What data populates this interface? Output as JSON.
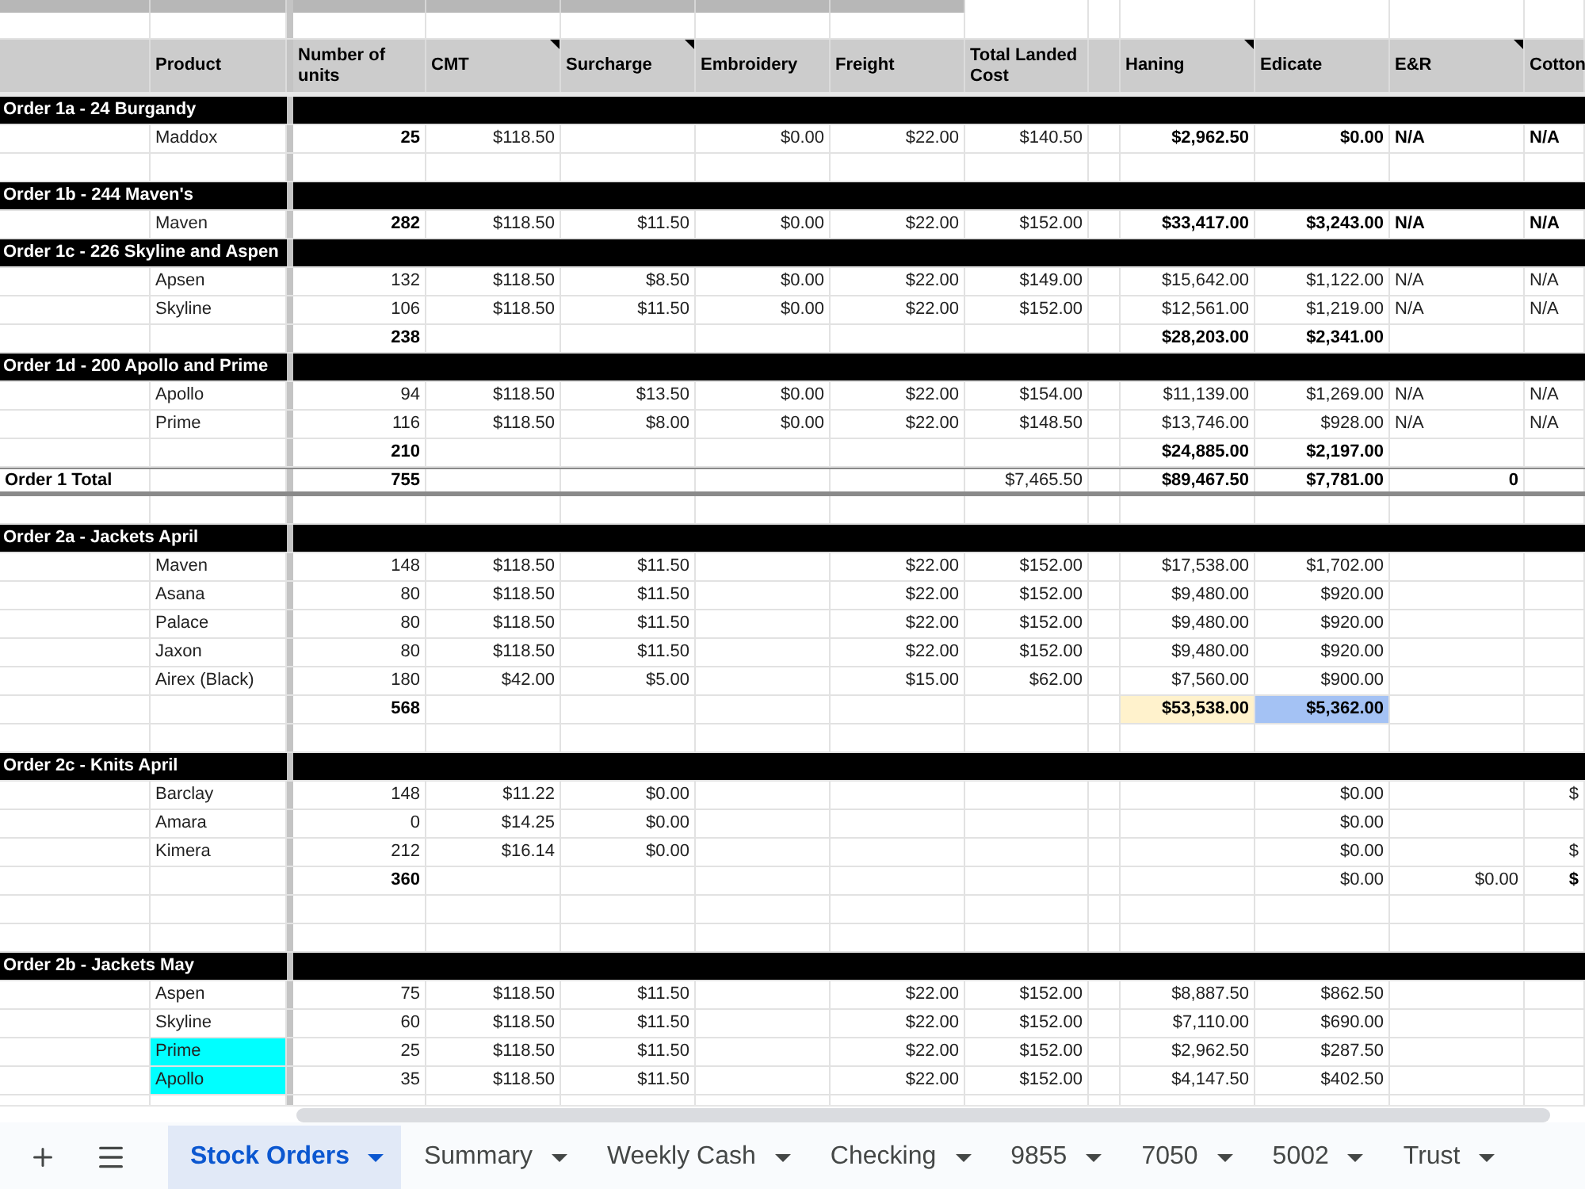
{
  "columns": [
    {
      "note": false
    },
    {
      "label": "Product",
      "note": false
    },
    {
      "label": "Number of units",
      "note": false
    },
    {
      "label": "CMT",
      "note": true
    },
    {
      "label": "Surcharge",
      "note": true
    },
    {
      "label": "Embroidery",
      "note": false
    },
    {
      "label": "Freight",
      "note": false
    },
    {
      "label": "Total Landed Cost",
      "note": false
    },
    {
      "note": false
    },
    {
      "label": "Haning",
      "note": true
    },
    {
      "label": "Edicate",
      "note": false
    },
    {
      "label": "E&R",
      "note": true
    },
    {
      "label": "Cotton",
      "note": false
    }
  ],
  "rows": [
    {
      "kind": "group",
      "label": "Order 1a - 24 Burgandy"
    },
    {
      "kind": "data",
      "cells": {
        "product": {
          "text": "Maddox",
          "bold": false
        },
        "number_of_units": {
          "text": "25",
          "bold": true
        },
        "cmt": {
          "text": "$118.50",
          "bold": false
        },
        "embroidery": {
          "text": "$0.00",
          "bold": false
        },
        "freight": {
          "text": "$22.00",
          "bold": false
        },
        "total_landed_cost": {
          "text": "$140.50",
          "bold": false
        },
        "haning": {
          "text": "$2,962.50",
          "bold": true
        },
        "edicate": {
          "text": "$0.00",
          "bold": true
        },
        "e_r": {
          "text": "N/A",
          "bold": true
        },
        "cotton": {
          "text": "N/A",
          "bold": true
        }
      }
    },
    {
      "kind": "blank"
    },
    {
      "kind": "group",
      "label": "Order 1b - 244 Maven's"
    },
    {
      "kind": "data",
      "cells": {
        "product": {
          "text": "Maven",
          "bold": false
        },
        "number_of_units": {
          "text": "282",
          "bold": true
        },
        "cmt": {
          "text": "$118.50",
          "bold": false
        },
        "surcharge": {
          "text": "$11.50",
          "bold": false
        },
        "embroidery": {
          "text": "$0.00",
          "bold": false
        },
        "freight": {
          "text": "$22.00",
          "bold": false
        },
        "total_landed_cost": {
          "text": "$152.00",
          "bold": false
        },
        "haning": {
          "text": "$33,417.00",
          "bold": true
        },
        "edicate": {
          "text": "$3,243.00",
          "bold": true
        },
        "e_r": {
          "text": "N/A",
          "bold": true
        },
        "cotton": {
          "text": "N/A",
          "bold": true
        }
      }
    },
    {
      "kind": "group",
      "label": "Order 1c - 226 Skyline and Aspen"
    },
    {
      "kind": "data",
      "cells": {
        "product": {
          "text": "Apsen",
          "bold": false
        },
        "number_of_units": {
          "text": "132",
          "bold": false
        },
        "cmt": {
          "text": "$118.50",
          "bold": false
        },
        "surcharge": {
          "text": "$8.50",
          "bold": false
        },
        "embroidery": {
          "text": "$0.00",
          "bold": false
        },
        "freight": {
          "text": "$22.00",
          "bold": false
        },
        "total_landed_cost": {
          "text": "$149.00",
          "bold": false
        },
        "haning": {
          "text": "$15,642.00",
          "bold": false
        },
        "edicate": {
          "text": "$1,122.00",
          "bold": false
        },
        "e_r": {
          "text": "N/A",
          "bold": false
        },
        "cotton": {
          "text": "N/A",
          "bold": false
        }
      }
    },
    {
      "kind": "data",
      "cells": {
        "product": {
          "text": "Skyline",
          "bold": false
        },
        "number_of_units": {
          "text": "106",
          "bold": false
        },
        "cmt": {
          "text": "$118.50",
          "bold": false
        },
        "surcharge": {
          "text": "$11.50",
          "bold": false
        },
        "embroidery": {
          "text": "$0.00",
          "bold": false
        },
        "freight": {
          "text": "$22.00",
          "bold": false
        },
        "total_landed_cost": {
          "text": "$152.00",
          "bold": false
        },
        "haning": {
          "text": "$12,561.00",
          "bold": false
        },
        "edicate": {
          "text": "$1,219.00",
          "bold": false
        },
        "e_r": {
          "text": "N/A",
          "bold": false
        },
        "cotton": {
          "text": "N/A",
          "bold": false
        }
      }
    },
    {
      "kind": "data",
      "cells": {
        "number_of_units": {
          "text": "238",
          "bold": true
        },
        "haning": {
          "text": "$28,203.00",
          "bold": true
        },
        "edicate": {
          "text": "$2,341.00",
          "bold": true
        }
      }
    },
    {
      "kind": "group",
      "label": "Order 1d - 200 Apollo and Prime"
    },
    {
      "kind": "data",
      "cells": {
        "product": {
          "text": "Apollo",
          "bold": false
        },
        "number_of_units": {
          "text": "94",
          "bold": false
        },
        "cmt": {
          "text": "$118.50",
          "bold": false
        },
        "surcharge": {
          "text": "$13.50",
          "bold": false
        },
        "embroidery": {
          "text": "$0.00",
          "bold": false
        },
        "freight": {
          "text": "$22.00",
          "bold": false
        },
        "total_landed_cost": {
          "text": "$154.00",
          "bold": false
        },
        "haning": {
          "text": "$11,139.00",
          "bold": false
        },
        "edicate": {
          "text": "$1,269.00",
          "bold": false
        },
        "e_r": {
          "text": "N/A",
          "bold": false
        },
        "cotton": {
          "text": "N/A",
          "bold": false
        }
      }
    },
    {
      "kind": "data",
      "cells": {
        "product": {
          "text": "Prime",
          "bold": false
        },
        "number_of_units": {
          "text": "116",
          "bold": false
        },
        "cmt": {
          "text": "$118.50",
          "bold": false
        },
        "surcharge": {
          "text": "$8.00",
          "bold": false
        },
        "embroidery": {
          "text": "$0.00",
          "bold": false
        },
        "freight": {
          "text": "$22.00",
          "bold": false
        },
        "total_landed_cost": {
          "text": "$148.50",
          "bold": false
        },
        "haning": {
          "text": "$13,746.00",
          "bold": false
        },
        "edicate": {
          "text": "$928.00",
          "bold": false
        },
        "e_r": {
          "text": "N/A",
          "bold": false
        },
        "cotton": {
          "text": "N/A",
          "bold": false
        }
      }
    },
    {
      "kind": "data",
      "cells": {
        "number_of_units": {
          "text": "210",
          "bold": true
        },
        "haning": {
          "text": "$24,885.00",
          "bold": true
        },
        "edicate": {
          "text": "$2,197.00",
          "bold": true
        }
      }
    },
    {
      "kind": "total",
      "cells": {
        "column_1": {
          "text": "Order 1 Total",
          "bold": true
        },
        "number_of_units": {
          "text": "755",
          "bold": true
        },
        "total_landed_cost": {
          "text": "$7,465.50",
          "bold": false
        },
        "haning": {
          "text": "$89,467.50",
          "bold": true
        },
        "edicate": {
          "text": "$7,781.00",
          "bold": true
        },
        "e_r": {
          "text": "0",
          "bold": true
        }
      }
    },
    {
      "kind": "blank"
    },
    {
      "kind": "group",
      "label": "Order 2a - Jackets April"
    },
    {
      "kind": "data",
      "cells": {
        "product": {
          "text": "Maven",
          "bold": false
        },
        "number_of_units": {
          "text": "148",
          "bold": false
        },
        "cmt": {
          "text": "$118.50",
          "bold": false
        },
        "surcharge": {
          "text": "$11.50",
          "bold": false
        },
        "freight": {
          "text": "$22.00",
          "bold": false
        },
        "total_landed_cost": {
          "text": "$152.00",
          "bold": false
        },
        "haning": {
          "text": "$17,538.00",
          "bold": false
        },
        "edicate": {
          "text": "$1,702.00",
          "bold": false
        }
      }
    },
    {
      "kind": "data",
      "cells": {
        "product": {
          "text": "Asana",
          "bold": false
        },
        "number_of_units": {
          "text": "80",
          "bold": false
        },
        "cmt": {
          "text": "$118.50",
          "bold": false
        },
        "surcharge": {
          "text": "$11.50",
          "bold": false
        },
        "freight": {
          "text": "$22.00",
          "bold": false
        },
        "total_landed_cost": {
          "text": "$152.00",
          "bold": false
        },
        "haning": {
          "text": "$9,480.00",
          "bold": false
        },
        "edicate": {
          "text": "$920.00",
          "bold": false
        }
      }
    },
    {
      "kind": "data",
      "cells": {
        "product": {
          "text": "Palace",
          "bold": false
        },
        "number_of_units": {
          "text": "80",
          "bold": false
        },
        "cmt": {
          "text": "$118.50",
          "bold": false
        },
        "surcharge": {
          "text": "$11.50",
          "bold": false
        },
        "freight": {
          "text": "$22.00",
          "bold": false
        },
        "total_landed_cost": {
          "text": "$152.00",
          "bold": false
        },
        "haning": {
          "text": "$9,480.00",
          "bold": false
        },
        "edicate": {
          "text": "$920.00",
          "bold": false
        }
      }
    },
    {
      "kind": "data",
      "cells": {
        "product": {
          "text": "Jaxon",
          "bold": false
        },
        "number_of_units": {
          "text": "80",
          "bold": false
        },
        "cmt": {
          "text": "$118.50",
          "bold": false
        },
        "surcharge": {
          "text": "$11.50",
          "bold": false
        },
        "freight": {
          "text": "$22.00",
          "bold": false
        },
        "total_landed_cost": {
          "text": "$152.00",
          "bold": false
        },
        "haning": {
          "text": "$9,480.00",
          "bold": false
        },
        "edicate": {
          "text": "$920.00",
          "bold": false
        }
      }
    },
    {
      "kind": "data",
      "cells": {
        "product": {
          "text": "Airex (Black)",
          "bold": false
        },
        "number_of_units": {
          "text": "180",
          "bold": false
        },
        "cmt": {
          "text": "$42.00",
          "bold": false
        },
        "surcharge": {
          "text": "$5.00",
          "bold": false
        },
        "freight": {
          "text": "$15.00",
          "bold": false
        },
        "total_landed_cost": {
          "text": "$62.00",
          "bold": false
        },
        "haning": {
          "text": "$7,560.00",
          "bold": false
        },
        "edicate": {
          "text": "$900.00",
          "bold": false
        }
      }
    },
    {
      "kind": "data",
      "cells": {
        "number_of_units": {
          "text": "568",
          "bold": true
        },
        "haning": {
          "text": "$53,538.00",
          "bold": true,
          "color": "#fff2cc"
        },
        "edicate": {
          "text": "$5,362.00",
          "bold": true,
          "color": "#a4c2f4"
        }
      }
    },
    {
      "kind": "blank"
    },
    {
      "kind": "group",
      "label": "Order 2c - Knits April"
    },
    {
      "kind": "data",
      "cells": {
        "product": {
          "text": "Barclay",
          "bold": false
        },
        "number_of_units": {
          "text": "148",
          "bold": false
        },
        "cmt": {
          "text": "$11.22",
          "bold": false
        },
        "surcharge": {
          "text": "$0.00",
          "bold": false
        },
        "edicate": {
          "text": "$0.00",
          "bold": false
        },
        "cotton": {
          "text": "$",
          "bold": false
        }
      }
    },
    {
      "kind": "data",
      "cells": {
        "product": {
          "text": "Amara",
          "bold": false
        },
        "number_of_units": {
          "text": "0",
          "bold": false
        },
        "cmt": {
          "text": "$14.25",
          "bold": false
        },
        "surcharge": {
          "text": "$0.00",
          "bold": false
        },
        "edicate": {
          "text": "$0.00",
          "bold": false
        }
      }
    },
    {
      "kind": "data",
      "cells": {
        "product": {
          "text": "Kimera",
          "bold": false
        },
        "number_of_units": {
          "text": "212",
          "bold": false
        },
        "cmt": {
          "text": "$16.14",
          "bold": false
        },
        "surcharge": {
          "text": "$0.00",
          "bold": false
        },
        "edicate": {
          "text": "$0.00",
          "bold": false
        },
        "cotton": {
          "text": "$",
          "bold": false
        }
      }
    },
    {
      "kind": "data",
      "cells": {
        "number_of_units": {
          "text": "360",
          "bold": true
        },
        "edicate": {
          "text": "$0.00",
          "bold": false
        },
        "e_r": {
          "text": "$0.00",
          "bold": false
        },
        "cotton": {
          "text": "$",
          "bold": true
        }
      }
    },
    {
      "kind": "blank"
    },
    {
      "kind": "blank"
    },
    {
      "kind": "group",
      "label": "Order 2b - Jackets May"
    },
    {
      "kind": "data",
      "cells": {
        "product": {
          "text": "Aspen",
          "bold": false
        },
        "number_of_units": {
          "text": "75",
          "bold": false
        },
        "cmt": {
          "text": "$118.50",
          "bold": false
        },
        "surcharge": {
          "text": "$11.50",
          "bold": false
        },
        "freight": {
          "text": "$22.00",
          "bold": false
        },
        "total_landed_cost": {
          "text": "$152.00",
          "bold": false
        },
        "haning": {
          "text": "$8,887.50",
          "bold": false
        },
        "edicate": {
          "text": "$862.50",
          "bold": false
        }
      }
    },
    {
      "kind": "data",
      "cells": {
        "product": {
          "text": "Skyline",
          "bold": false
        },
        "number_of_units": {
          "text": "60",
          "bold": false
        },
        "cmt": {
          "text": "$118.50",
          "bold": false
        },
        "surcharge": {
          "text": "$11.50",
          "bold": false
        },
        "freight": {
          "text": "$22.00",
          "bold": false
        },
        "total_landed_cost": {
          "text": "$152.00",
          "bold": false
        },
        "haning": {
          "text": "$7,110.00",
          "bold": false
        },
        "edicate": {
          "text": "$690.00",
          "bold": false
        }
      }
    },
    {
      "kind": "data",
      "cells": {
        "product": {
          "text": "Prime",
          "bold": false,
          "color": "#00ffff"
        },
        "number_of_units": {
          "text": "25",
          "bold": false
        },
        "cmt": {
          "text": "$118.50",
          "bold": false
        },
        "surcharge": {
          "text": "$11.50",
          "bold": false
        },
        "freight": {
          "text": "$22.00",
          "bold": false
        },
        "total_landed_cost": {
          "text": "$152.00",
          "bold": false
        },
        "haning": {
          "text": "$2,962.50",
          "bold": false
        },
        "edicate": {
          "text": "$287.50",
          "bold": false
        }
      }
    },
    {
      "kind": "data",
      "cells": {
        "product": {
          "text": "Apollo",
          "bold": false,
          "color": "#00ffff"
        },
        "number_of_units": {
          "text": "35",
          "bold": false
        },
        "cmt": {
          "text": "$118.50",
          "bold": false
        },
        "surcharge": {
          "text": "$11.50",
          "bold": false
        },
        "freight": {
          "text": "$22.00",
          "bold": false
        },
        "total_landed_cost": {
          "text": "$152.00",
          "bold": false
        },
        "haning": {
          "text": "$4,147.50",
          "bold": false
        },
        "edicate": {
          "text": "$402.50",
          "bold": false
        }
      }
    },
    {
      "kind": "blank"
    }
  ],
  "sheet_tabs": [
    {
      "label": "Stock Orders",
      "selected": true
    },
    {
      "label": "Summary",
      "selected": false
    },
    {
      "label": "Weekly Cash",
      "selected": false
    },
    {
      "label": "Checking",
      "selected": false
    },
    {
      "label": "9855",
      "selected": false
    },
    {
      "label": "7050",
      "selected": false
    },
    {
      "label": "5002",
      "selected": false
    },
    {
      "label": "Trust",
      "selected": false
    }
  ]
}
